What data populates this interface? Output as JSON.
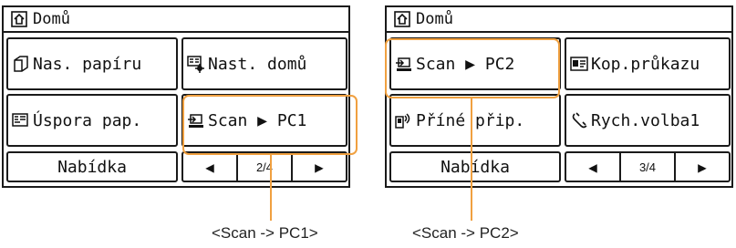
{
  "colors": {
    "highlight": "#f0a040",
    "border": "#1a1a1a"
  },
  "panels": [
    {
      "header": {
        "title": "Domů",
        "icon": "home-icon"
      },
      "buttons": [
        {
          "label": "Nas. papíru",
          "icon": "paper-icon"
        },
        {
          "label": "Nast. domů",
          "icon": "home-settings-icon"
        },
        {
          "label": "Úspora pap.",
          "icon": "paper-save-icon"
        },
        {
          "label": "Scan ▶ PC1",
          "icon": "scan-tray-icon"
        }
      ],
      "footer": {
        "menu_label": "Nabídka",
        "page": "2/4"
      },
      "callout": "<Scan -> PC1>"
    },
    {
      "header": {
        "title": "Domů",
        "icon": "home-icon"
      },
      "buttons": [
        {
          "label": "Scan ▶ PC2",
          "icon": "scan-tray-icon"
        },
        {
          "label": "Kop.průkazu",
          "icon": "id-card-icon"
        },
        {
          "label": "Příné přip.",
          "icon": "direct-connect-icon"
        },
        {
          "label": "Rych.volba1",
          "icon": "speed-dial-icon"
        }
      ],
      "footer": {
        "menu_label": "Nabídka",
        "page": "3/4"
      },
      "callout": "<Scan -> PC2>"
    }
  ]
}
